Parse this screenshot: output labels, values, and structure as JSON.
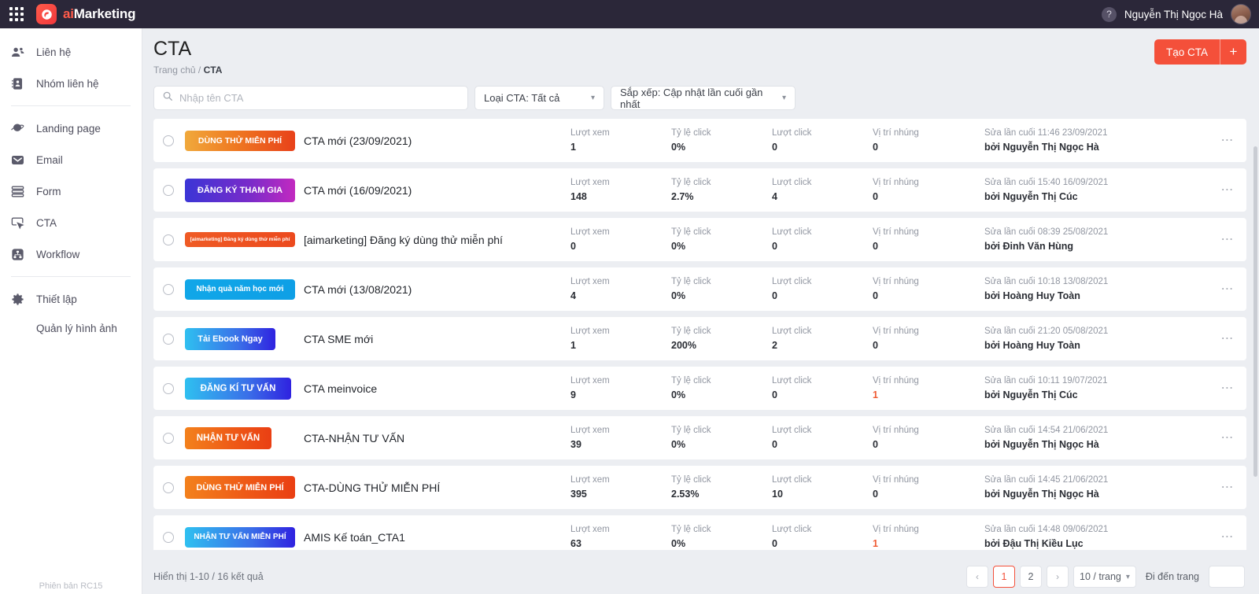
{
  "topbar": {
    "grid_icon": "apps-grid-icon",
    "logo_ai": "ai",
    "logo_rest": "Marketing",
    "help_icon": "?",
    "user_name": "Nguyễn Thị Ngọc Hà"
  },
  "sidebar": {
    "items": [
      {
        "label": "Liên hệ",
        "icon": "contacts-icon"
      },
      {
        "label": "Nhóm liên hệ",
        "icon": "contact-group-icon"
      },
      {
        "label": "Landing page",
        "icon": "landing-page-icon"
      },
      {
        "label": "Email",
        "icon": "email-icon"
      },
      {
        "label": "Form",
        "icon": "form-icon"
      },
      {
        "label": "CTA",
        "icon": "cta-icon"
      },
      {
        "label": "Workflow",
        "icon": "workflow-icon"
      },
      {
        "label": "Thiết lập",
        "icon": "settings-icon"
      }
    ],
    "sub_item": "Quản lý hình ảnh",
    "version": "Phiên bản RC15"
  },
  "page": {
    "title": "CTA",
    "breadcrumb_home": "Trang chủ",
    "breadcrumb_sep": " / ",
    "breadcrumb_current": "CTA",
    "create_label": "Tạo CTA",
    "create_plus": "+",
    "accent_color": "#f4503a"
  },
  "filters": {
    "search_placeholder": "Nhập tên CTA",
    "search_value": "",
    "type_select": "Loại CTA: Tất cả",
    "sort_select": "Sắp xếp: Cập nhật lần cuối gần nhất"
  },
  "columns": {
    "views": "Lượt xem",
    "ctr": "Tỷ lệ click",
    "clicks": "Lượt click",
    "embeds": "Vị trí nhúng",
    "edited_prefix": "Sửa lần cuối",
    "by_prefix": "bởi"
  },
  "rows": [
    {
      "badge_text": "DÙNG THỬ MIỄN PHÍ",
      "badge_style": "grad-orange-yellow",
      "badge_font": 10.5,
      "badge_w": 140,
      "badge_h": 26,
      "name": "CTA mới (23/09/2021)",
      "views": "1",
      "ctr": "0%",
      "clicks": "0",
      "embeds": "0",
      "embeds_hi": false,
      "edited": "Sửa lần cuối 11:46 23/09/2021",
      "by": "bởi Nguyễn Thị Ngọc Hà"
    },
    {
      "badge_text": "ĐĂNG KÝ THAM GIA",
      "badge_style": "grad-blue-magenta",
      "badge_font": 11,
      "badge_w": 140,
      "badge_h": 30,
      "name": "CTA mới (16/09/2021)",
      "views": "148",
      "ctr": "2.7%",
      "clicks": "4",
      "embeds": "0",
      "embeds_hi": false,
      "edited": "Sửa lần cuối 15:40 16/09/2021",
      "by": "bởi Nguyễn Thị Cúc"
    },
    {
      "badge_text": "[aimarketing] Đăng ký dùng thử miễn phí",
      "badge_style": "solid-orange-red",
      "badge_font": 6.5,
      "badge_w": 140,
      "badge_h": 19,
      "name": "[aimarketing] Đăng ký dùng thử miễn phí",
      "views": "0",
      "ctr": "0%",
      "clicks": "0",
      "embeds": "0",
      "embeds_hi": false,
      "edited": "Sửa lần cuối 08:39 25/08/2021",
      "by": "bởi Đinh Văn Hùng"
    },
    {
      "badge_text": "Nhận quà năm học mới",
      "badge_style": "solid-cyan-blue",
      "badge_font": 10,
      "badge_w": 140,
      "badge_h": 26,
      "name": "CTA mới (13/08/2021)",
      "views": "4",
      "ctr": "0%",
      "clicks": "0",
      "embeds": "0",
      "embeds_hi": false,
      "edited": "Sửa lần cuối 10:18 13/08/2021",
      "by": "bởi Hoàng Huy Toàn"
    },
    {
      "badge_text": "Tải Ebook Ngay",
      "badge_style": "grad-cyan-indigo",
      "badge_font": 11,
      "badge_w": 115,
      "badge_h": 28,
      "name": "CTA SME mới",
      "views": "1",
      "ctr": "200%",
      "clicks": "2",
      "embeds": "0",
      "embeds_hi": false,
      "edited": "Sửa lần cuối 21:20 05/08/2021",
      "by": "bởi Hoàng Huy Toàn"
    },
    {
      "badge_text": "ĐĂNG KÍ TƯ VẤN",
      "badge_style": "grad-cyan-indigo",
      "badge_font": 11.5,
      "badge_w": 135,
      "badge_h": 28,
      "name": "CTA meinvoice",
      "views": "9",
      "ctr": "0%",
      "clicks": "0",
      "embeds": "1",
      "embeds_hi": true,
      "edited": "Sửa lần cuối 10:11 19/07/2021",
      "by": "bởi Nguyễn Thị Cúc"
    },
    {
      "badge_text": "NHẬN TƯ VẤN",
      "badge_style": "grad-orange-red",
      "badge_font": 11.5,
      "badge_w": 110,
      "badge_h": 28,
      "name": "CTA-NHẬN TƯ VẤN",
      "views": "39",
      "ctr": "0%",
      "clicks": "0",
      "embeds": "0",
      "embeds_hi": false,
      "edited": "Sửa lần cuối 14:54 21/06/2021",
      "by": "bởi Nguyễn Thị Ngọc Hà"
    },
    {
      "badge_text": "DÙNG THỬ MIỄN PHÍ",
      "badge_style": "grad-orange-red",
      "badge_font": 11,
      "badge_w": 140,
      "badge_h": 29,
      "name": "CTA-DÙNG THỬ MIỄN PHÍ",
      "views": "395",
      "ctr": "2.53%",
      "clicks": "10",
      "embeds": "0",
      "embeds_hi": false,
      "edited": "Sửa lần cuối 14:45 21/06/2021",
      "by": "bởi Nguyễn Thị Ngọc Hà"
    },
    {
      "badge_text": "NHẬN TƯ VẤN MIỄN PHÍ",
      "badge_style": "grad-cyan-indigo",
      "badge_font": 10,
      "badge_w": 140,
      "badge_h": 26,
      "name": "AMIS Kế toán_CTA1",
      "views": "63",
      "ctr": "0%",
      "clicks": "0",
      "embeds": "1",
      "embeds_hi": true,
      "edited": "Sửa lần cuối 14:48 09/06/2021",
      "by": "bởi Đậu Thị Kiều Lục"
    }
  ],
  "footer": {
    "result_text": "Hiển thị 1-10 / 16 kết quả",
    "prev": "‹",
    "pages": [
      "1",
      "2"
    ],
    "active_page": "1",
    "next": "›",
    "per_page": "10 / trang",
    "goto_label": "Đi đến trang",
    "goto_value": ""
  }
}
